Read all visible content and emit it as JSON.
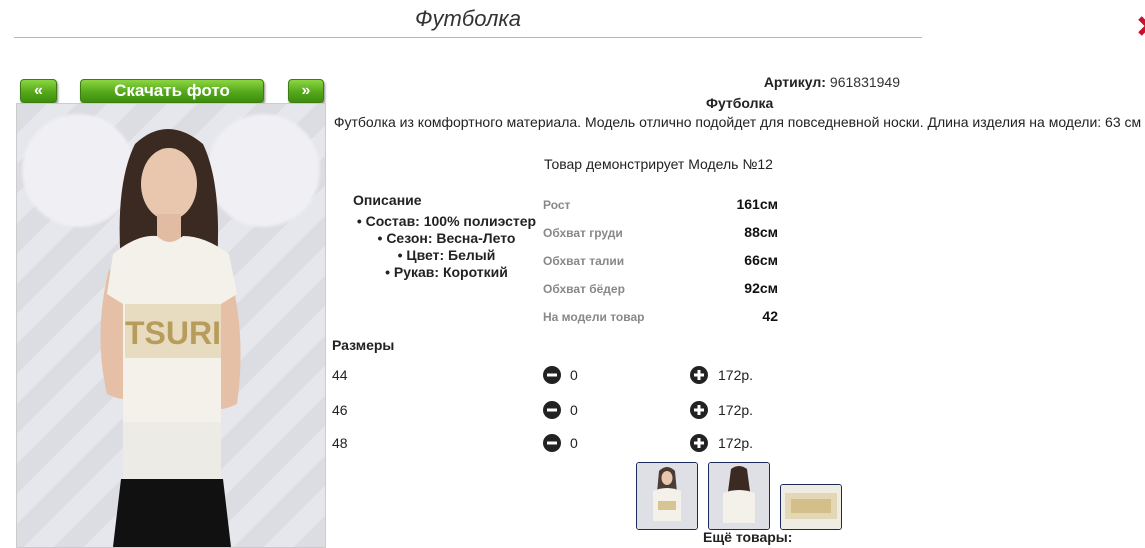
{
  "header": {
    "title": "Футболка"
  },
  "gallery": {
    "prev_label": "«",
    "download_label": "Скачать фото",
    "next_label": "»"
  },
  "product": {
    "article_label": "Артикул:",
    "article_value": "961831949",
    "name": "Футболка",
    "description": "Футболка из комфортного материала. Модель отлично подойдет для повседневной носки. Длина изделия на модели: 63 см",
    "model_note": "Товар демонстрирует Модель №12"
  },
  "details": {
    "heading": "Описание",
    "items": [
      "• Состав: 100% полиэстер",
      "• Сезон: Весна-Лето",
      "• Цвет: Белый",
      "• Рукав: Короткий"
    ]
  },
  "measurements": [
    {
      "label": "Рост",
      "value": "161см"
    },
    {
      "label": "Обхват груди",
      "value": "88см"
    },
    {
      "label": "Обхват талии",
      "value": "66см"
    },
    {
      "label": "Обхват бёдер",
      "value": "92см"
    },
    {
      "label": "На модели товар",
      "value": "42"
    }
  ],
  "sizes": {
    "heading": "Размеры",
    "rows": [
      {
        "size": "44",
        "qty": "0",
        "price": "172р."
      },
      {
        "size": "46",
        "qty": "0",
        "price": "172р."
      },
      {
        "size": "48",
        "qty": "0",
        "price": "172р."
      }
    ]
  },
  "more_label": "Ещё товары:",
  "colors": {
    "button_green": "#54a81a",
    "close_red": "#c8102e",
    "thumb_border": "#1a2a5a"
  }
}
